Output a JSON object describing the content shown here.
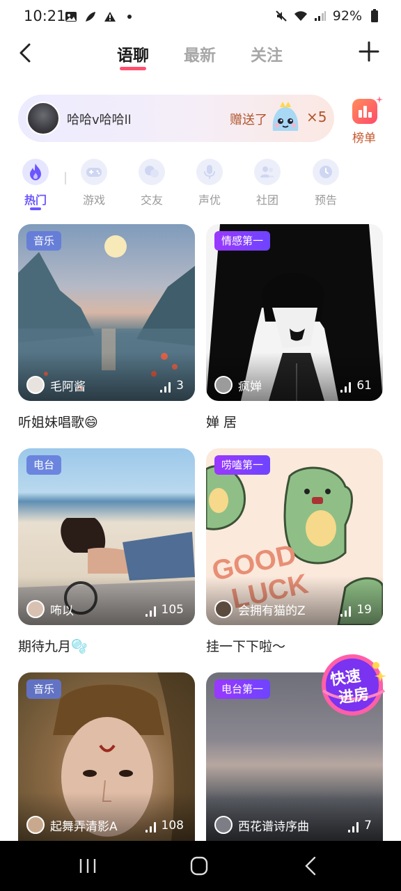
{
  "status_bar": {
    "time": "10:21",
    "battery": "92%"
  },
  "top_nav": {
    "tabs": [
      {
        "label": "语聊",
        "active": true
      },
      {
        "label": "最新",
        "active": false
      },
      {
        "label": "关注",
        "active": false
      }
    ]
  },
  "gift_banner": {
    "sender": "哈哈v哈哈ll",
    "action": "赠送了",
    "count": "×5"
  },
  "rank": {
    "label": "榜单"
  },
  "categories": [
    {
      "label": "热门",
      "icon": "flame-icon",
      "active": true
    },
    {
      "label": "游戏",
      "icon": "gamepad-icon",
      "active": false
    },
    {
      "label": "交友",
      "icon": "chat-bubbles-icon",
      "active": false
    },
    {
      "label": "声优",
      "icon": "microphone-icon",
      "active": false
    },
    {
      "label": "社团",
      "icon": "group-icon",
      "active": false
    },
    {
      "label": "预告",
      "icon": "clock-icon",
      "active": false
    }
  ],
  "rooms": [
    {
      "tag": "音乐",
      "user": "毛阿酱",
      "count": "3",
      "title": "听姐妹唱歌😄"
    },
    {
      "tag": "情感第一",
      "user": "疯婵",
      "count": "61",
      "title": "婵 居"
    },
    {
      "tag": "电台",
      "user": "咘以",
      "count": "105",
      "title": "期待九月🫧"
    },
    {
      "tag": "唠嗑第一",
      "user": "会拥有猫的Z",
      "count": "19",
      "title": "挂一下下啦～"
    },
    {
      "tag": "音乐",
      "user": "起舞弄清影A",
      "count": "108",
      "title": ""
    },
    {
      "tag": "电台第一",
      "user": "西花谱诗序曲",
      "count": "7",
      "title": ""
    }
  ],
  "floating_badge": {
    "line1": "快速",
    "line2": "进房"
  },
  "colors": {
    "accent": "#6b56ff",
    "tab_underline": "#ff4f6e",
    "gift_text": "#b0542a"
  }
}
